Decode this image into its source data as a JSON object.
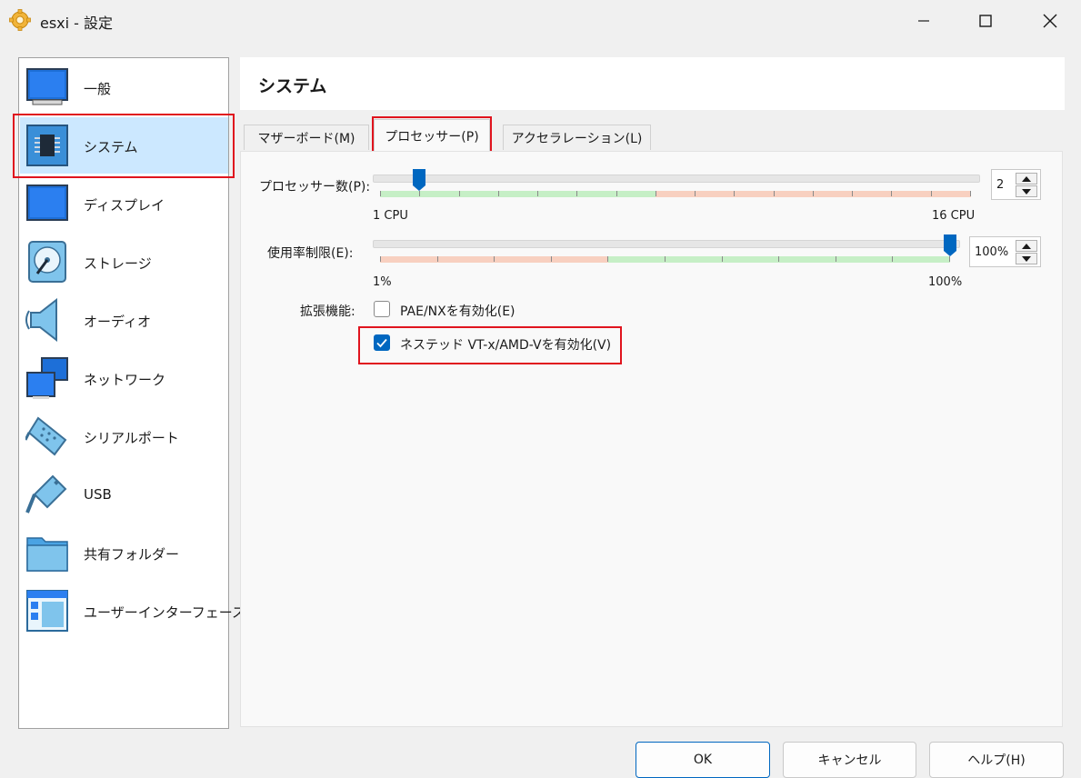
{
  "window": {
    "title": "esxi - 設定"
  },
  "sidebar": {
    "items": [
      {
        "label": "一般"
      },
      {
        "label": "システム"
      },
      {
        "label": "ディスプレイ"
      },
      {
        "label": "ストレージ"
      },
      {
        "label": "オーディオ"
      },
      {
        "label": "ネットワーク"
      },
      {
        "label": "シリアルポート"
      },
      {
        "label": "USB"
      },
      {
        "label": "共有フォルダー"
      },
      {
        "label": "ユーザーインターフェース"
      }
    ],
    "selected_index": 1
  },
  "page": {
    "title": "システム"
  },
  "tabs": [
    {
      "label": "マザーボード(M)"
    },
    {
      "label": "プロセッサー(P)"
    },
    {
      "label": "アクセラレーション(L)"
    }
  ],
  "processor": {
    "label": "プロセッサー数(P):",
    "value": "2",
    "min_label": "1 CPU",
    "max_label": "16 CPU",
    "min": 1,
    "max": 16,
    "current": 2
  },
  "cap": {
    "label": "使用率制限(E):",
    "value": "100%",
    "min_label": "1%",
    "max_label": "100%",
    "current_percent": 100
  },
  "features": {
    "label": "拡張機能:",
    "pae_label": "PAE/NXを有効化(E)",
    "pae_checked": false,
    "nested_label": "ネステッド VT-x/AMD-Vを有効化(V)",
    "nested_checked": true
  },
  "buttons": {
    "ok": "OK",
    "cancel": "キャンセル",
    "help": "ヘルプ(H)"
  },
  "colors": {
    "accent": "#0067c0",
    "selection": "#cce8ff",
    "highlight_box": "#e0141e",
    "scale_green": "#c6efc6",
    "scale_red": "#f8d0c0"
  }
}
